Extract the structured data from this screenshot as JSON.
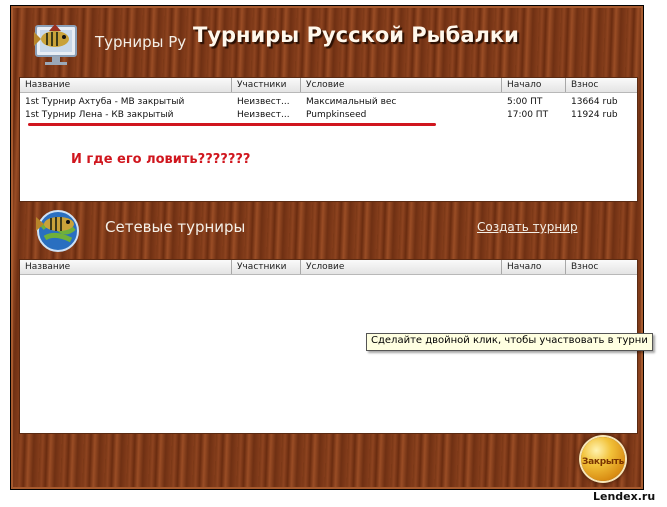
{
  "window": {
    "title_small": "Турниры Ру",
    "title_big": "Турниры Русской Рыбалки"
  },
  "columns": [
    "Название",
    "Участники",
    "Условие",
    "Начало",
    "Взнос"
  ],
  "top_table": {
    "rows": [
      {
        "name": "1st Турнир Ахтуба - МВ закрытый",
        "participants": "Неизвест...",
        "condition": "Максимальный вес",
        "start": "5:00 ПТ",
        "fee": "13664 rub"
      },
      {
        "name": "1st Турнир Лена - КВ закрытый",
        "participants": "Неизвест...",
        "condition": "Pumpkinseed",
        "start": "17:00 ПТ",
        "fee": "11924 rub"
      }
    ],
    "annotation": "И где его ловить???????"
  },
  "network": {
    "title": "Сетевые турниры",
    "create_link": "Создать турнир",
    "tooltip": "Сделайте двойной клик, чтобы участвовать в турни"
  },
  "close_button": "Закрыть",
  "watermark": "Lendex.ru",
  "colors": {
    "accent": "#d0161e",
    "wood": "#7a3716",
    "close_button": "#e8a31a"
  }
}
